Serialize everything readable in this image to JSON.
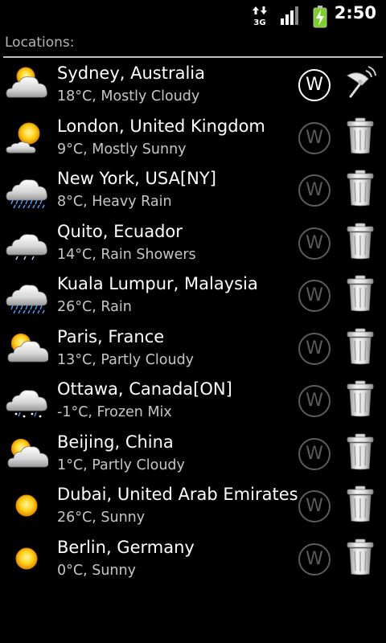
{
  "status_bar": {
    "network": "3G",
    "time": "2:50",
    "icons": [
      "data-arrows-icon",
      "signal-icon",
      "battery-charging-icon"
    ]
  },
  "header": {
    "title": "Locations:"
  },
  "locations": [
    {
      "name": "Sydney, Australia",
      "condition": "18°C, Mostly Cloudy",
      "icon": "mostly-cloudy-icon",
      "active": true,
      "action": "gps-icon"
    },
    {
      "name": "London, United Kingdom",
      "condition": "9°C, Mostly Sunny",
      "icon": "mostly-sunny-icon",
      "active": false,
      "action": "trash-icon"
    },
    {
      "name": "New York, USA[NY]",
      "condition": "8°C, Heavy Rain",
      "icon": "heavy-rain-icon",
      "active": false,
      "action": "trash-icon"
    },
    {
      "name": "Quito, Ecuador",
      "condition": "14°C, Rain Showers",
      "icon": "rain-showers-icon",
      "active": false,
      "action": "trash-icon"
    },
    {
      "name": "Kuala Lumpur, Malaysia",
      "condition": "26°C, Rain",
      "icon": "rain-icon",
      "active": false,
      "action": "trash-icon"
    },
    {
      "name": "Paris, France",
      "condition": "13°C, Partly Cloudy",
      "icon": "partly-cloudy-icon",
      "active": false,
      "action": "trash-icon"
    },
    {
      "name": "Ottawa, Canada[ON]",
      "condition": "-1°C, Frozen Mix",
      "icon": "frozen-mix-icon",
      "active": false,
      "action": "trash-icon"
    },
    {
      "name": "Beijing, China",
      "condition": "1°C, Partly Cloudy",
      "icon": "partly-cloudy-icon",
      "active": false,
      "action": "trash-icon"
    },
    {
      "name": "Dubai, United Arab Emirates",
      "condition": "26°C, Sunny",
      "icon": "sunny-icon",
      "active": false,
      "action": "trash-icon"
    },
    {
      "name": "Berlin, Germany",
      "condition": "0°C, Sunny",
      "icon": "sunny-icon",
      "active": false,
      "action": "trash-icon"
    }
  ],
  "w_button_label": "W"
}
